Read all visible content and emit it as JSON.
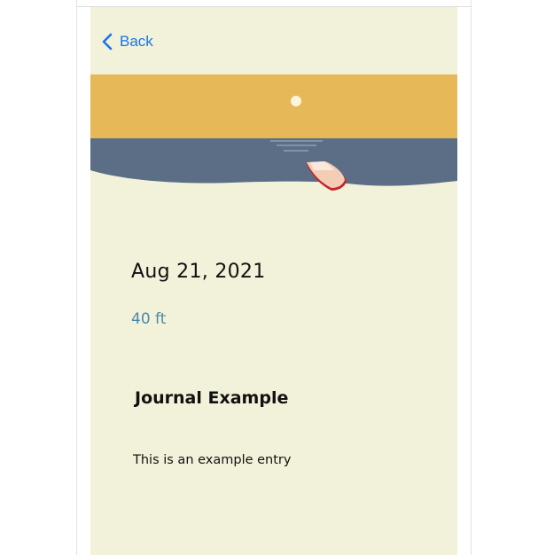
{
  "nav": {
    "back_label": "Back",
    "back_icon": "chevron-left-icon"
  },
  "banner": {
    "icon": "beach-boat-illustration",
    "colors": {
      "sky": "#e6b857",
      "sun": "#fdf6dc",
      "water": "#5b6e86",
      "sand": "#f2f2da",
      "boat_hull": "#f3cdb6",
      "boat_trim": "#c9242a"
    }
  },
  "entry": {
    "date": "Aug 21, 2021",
    "depth": "40 ft",
    "title": "Journal Example",
    "body": "This is an example entry"
  },
  "colors": {
    "background": "#f2f2da",
    "accent": "#1a73e8",
    "depth_text": "#4a8aa8"
  }
}
